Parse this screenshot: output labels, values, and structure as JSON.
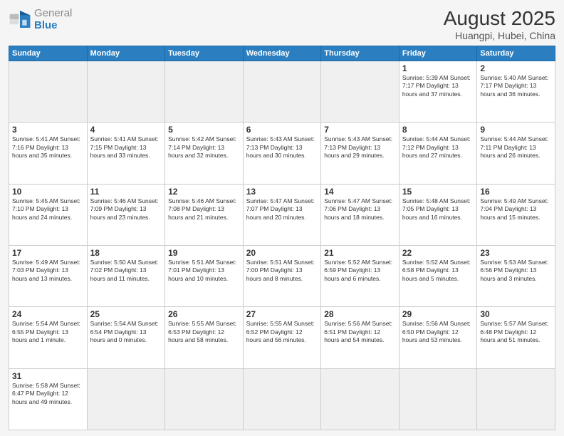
{
  "header": {
    "logo_general": "General",
    "logo_blue": "Blue",
    "month_year": "August 2025",
    "location": "Huangpi, Hubei, China"
  },
  "weekdays": [
    "Sunday",
    "Monday",
    "Tuesday",
    "Wednesday",
    "Thursday",
    "Friday",
    "Saturday"
  ],
  "weeks": [
    [
      {
        "day": "",
        "info": ""
      },
      {
        "day": "",
        "info": ""
      },
      {
        "day": "",
        "info": ""
      },
      {
        "day": "",
        "info": ""
      },
      {
        "day": "",
        "info": ""
      },
      {
        "day": "1",
        "info": "Sunrise: 5:39 AM\nSunset: 7:17 PM\nDaylight: 13 hours\nand 37 minutes."
      },
      {
        "day": "2",
        "info": "Sunrise: 5:40 AM\nSunset: 7:17 PM\nDaylight: 13 hours\nand 36 minutes."
      }
    ],
    [
      {
        "day": "3",
        "info": "Sunrise: 5:41 AM\nSunset: 7:16 PM\nDaylight: 13 hours\nand 35 minutes."
      },
      {
        "day": "4",
        "info": "Sunrise: 5:41 AM\nSunset: 7:15 PM\nDaylight: 13 hours\nand 33 minutes."
      },
      {
        "day": "5",
        "info": "Sunrise: 5:42 AM\nSunset: 7:14 PM\nDaylight: 13 hours\nand 32 minutes."
      },
      {
        "day": "6",
        "info": "Sunrise: 5:43 AM\nSunset: 7:13 PM\nDaylight: 13 hours\nand 30 minutes."
      },
      {
        "day": "7",
        "info": "Sunrise: 5:43 AM\nSunset: 7:13 PM\nDaylight: 13 hours\nand 29 minutes."
      },
      {
        "day": "8",
        "info": "Sunrise: 5:44 AM\nSunset: 7:12 PM\nDaylight: 13 hours\nand 27 minutes."
      },
      {
        "day": "9",
        "info": "Sunrise: 5:44 AM\nSunset: 7:11 PM\nDaylight: 13 hours\nand 26 minutes."
      }
    ],
    [
      {
        "day": "10",
        "info": "Sunrise: 5:45 AM\nSunset: 7:10 PM\nDaylight: 13 hours\nand 24 minutes."
      },
      {
        "day": "11",
        "info": "Sunrise: 5:46 AM\nSunset: 7:09 PM\nDaylight: 13 hours\nand 23 minutes."
      },
      {
        "day": "12",
        "info": "Sunrise: 5:46 AM\nSunset: 7:08 PM\nDaylight: 13 hours\nand 21 minutes."
      },
      {
        "day": "13",
        "info": "Sunrise: 5:47 AM\nSunset: 7:07 PM\nDaylight: 13 hours\nand 20 minutes."
      },
      {
        "day": "14",
        "info": "Sunrise: 5:47 AM\nSunset: 7:06 PM\nDaylight: 13 hours\nand 18 minutes."
      },
      {
        "day": "15",
        "info": "Sunrise: 5:48 AM\nSunset: 7:05 PM\nDaylight: 13 hours\nand 16 minutes."
      },
      {
        "day": "16",
        "info": "Sunrise: 5:49 AM\nSunset: 7:04 PM\nDaylight: 13 hours\nand 15 minutes."
      }
    ],
    [
      {
        "day": "17",
        "info": "Sunrise: 5:49 AM\nSunset: 7:03 PM\nDaylight: 13 hours\nand 13 minutes."
      },
      {
        "day": "18",
        "info": "Sunrise: 5:50 AM\nSunset: 7:02 PM\nDaylight: 13 hours\nand 11 minutes."
      },
      {
        "day": "19",
        "info": "Sunrise: 5:51 AM\nSunset: 7:01 PM\nDaylight: 13 hours\nand 10 minutes."
      },
      {
        "day": "20",
        "info": "Sunrise: 5:51 AM\nSunset: 7:00 PM\nDaylight: 13 hours\nand 8 minutes."
      },
      {
        "day": "21",
        "info": "Sunrise: 5:52 AM\nSunset: 6:59 PM\nDaylight: 13 hours\nand 6 minutes."
      },
      {
        "day": "22",
        "info": "Sunrise: 5:52 AM\nSunset: 6:58 PM\nDaylight: 13 hours\nand 5 minutes."
      },
      {
        "day": "23",
        "info": "Sunrise: 5:53 AM\nSunset: 6:56 PM\nDaylight: 13 hours\nand 3 minutes."
      }
    ],
    [
      {
        "day": "24",
        "info": "Sunrise: 5:54 AM\nSunset: 6:55 PM\nDaylight: 13 hours\nand 1 minute."
      },
      {
        "day": "25",
        "info": "Sunrise: 5:54 AM\nSunset: 6:54 PM\nDaylight: 13 hours\nand 0 minutes."
      },
      {
        "day": "26",
        "info": "Sunrise: 5:55 AM\nSunset: 6:53 PM\nDaylight: 12 hours\nand 58 minutes."
      },
      {
        "day": "27",
        "info": "Sunrise: 5:55 AM\nSunset: 6:52 PM\nDaylight: 12 hours\nand 56 minutes."
      },
      {
        "day": "28",
        "info": "Sunrise: 5:56 AM\nSunset: 6:51 PM\nDaylight: 12 hours\nand 54 minutes."
      },
      {
        "day": "29",
        "info": "Sunrise: 5:56 AM\nSunset: 6:50 PM\nDaylight: 12 hours\nand 53 minutes."
      },
      {
        "day": "30",
        "info": "Sunrise: 5:57 AM\nSunset: 6:48 PM\nDaylight: 12 hours\nand 51 minutes."
      }
    ],
    [
      {
        "day": "31",
        "info": "Sunrise: 5:58 AM\nSunset: 6:47 PM\nDaylight: 12 hours\nand 49 minutes."
      },
      {
        "day": "",
        "info": ""
      },
      {
        "day": "",
        "info": ""
      },
      {
        "day": "",
        "info": ""
      },
      {
        "day": "",
        "info": ""
      },
      {
        "day": "",
        "info": ""
      },
      {
        "day": "",
        "info": ""
      }
    ]
  ]
}
